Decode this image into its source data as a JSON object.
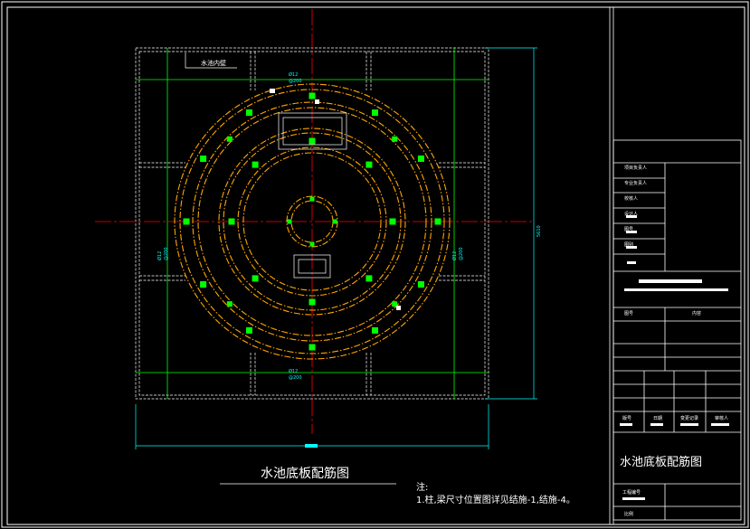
{
  "drawing": {
    "title": "水池底板配筋图",
    "note_label": "注:",
    "note_text": "1.柱,梁尺寸位置图详见结施-1,结施-4。",
    "inner_wall_label": "水池内壁",
    "gridline_label": "Ø12",
    "gridline_spacing": "@200",
    "dim_label": "5610",
    "colors": {
      "background": "#000000",
      "frame": "#ffffff",
      "ring": "#ffa500",
      "column": "#00ff00",
      "axis": "#ff0000",
      "rebar": "#00ff00",
      "dimension": "#00ffff"
    }
  },
  "title_block": {
    "rows": [
      "项目负责人",
      "专业负责人",
      "校核人",
      "设计人",
      "图号",
      "图别"
    ],
    "revision_header": [
      "图号",
      "内容"
    ],
    "sign_headers": [
      "版号",
      "日期",
      "变更记录",
      "审核人"
    ],
    "sheet_title": "水池底板配筋图",
    "project_no_label": "工程编号",
    "scale_label": "比例"
  }
}
